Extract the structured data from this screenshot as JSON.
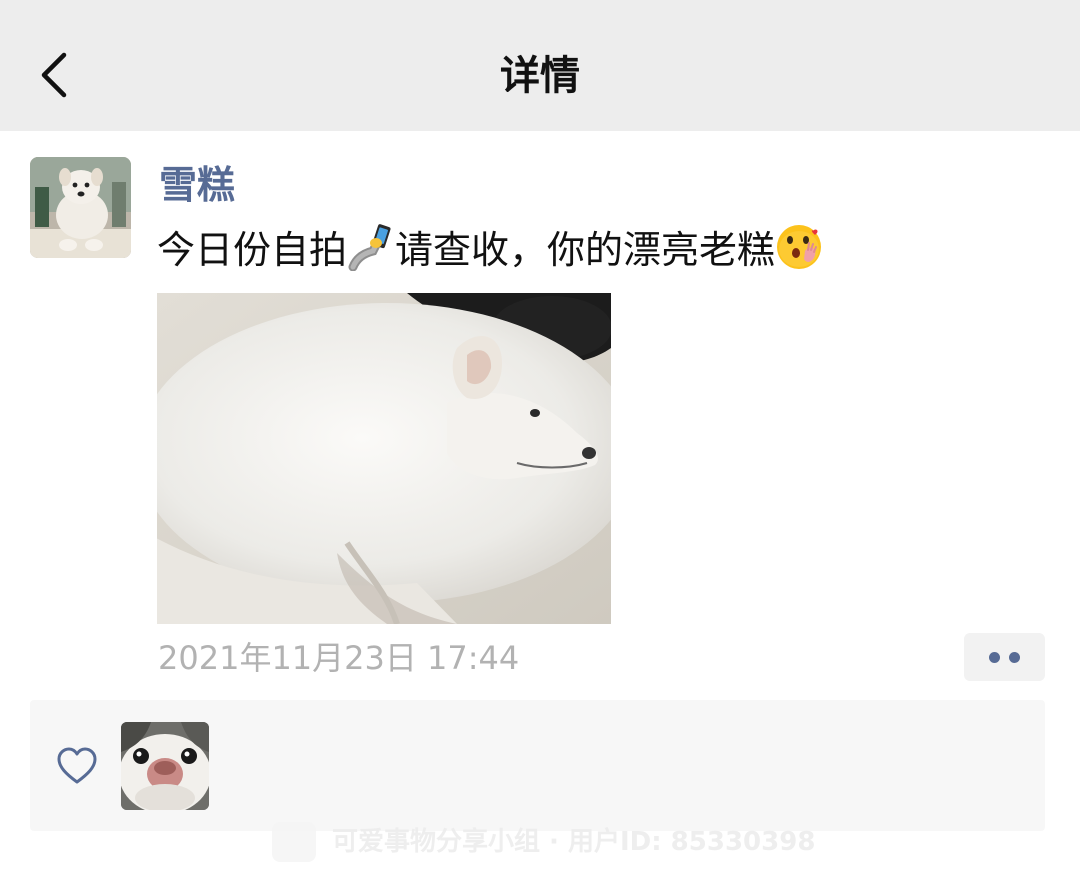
{
  "header": {
    "title": "详情",
    "back_icon": "chevron-left-icon"
  },
  "post": {
    "author": "雪糕",
    "text_before_emoji": "今日份自拍",
    "selfie_emoji": "selfie-icon",
    "text_after_emoji": "请查收，你的漂亮老糕",
    "kiss_emoji": "blowing-kiss-icon",
    "timestamp": "2021年11月23日 17:44",
    "more_icon": "more-dots-icon"
  },
  "likes": {
    "like_icon": "heart-outline-icon"
  },
  "watermark": {
    "text": "可爱事物分享小组 · 用户ID: 85330398"
  },
  "colors": {
    "nav_bg": "#ededed",
    "link_blue": "#576b95",
    "timestamp_gray": "#b2b2b2",
    "likes_bg": "#f7f7f7"
  }
}
